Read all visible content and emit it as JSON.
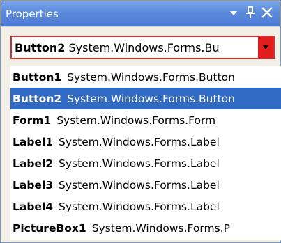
{
  "titlebar": {
    "title": "Properties",
    "dropdown_glyph": "▾",
    "pin_glyph": "ꟸ",
    "close_glyph": "✕"
  },
  "combo": {
    "selected_name": "Button2",
    "selected_type": "System.Windows.Forms.Bu",
    "drop_color": "#e11d1d"
  },
  "list": {
    "items": [
      {
        "name": "Button1",
        "type": "System.Windows.Forms.Button",
        "selected": false
      },
      {
        "name": "Button2",
        "type": "System.Windows.Forms.Button",
        "selected": true
      },
      {
        "name": "Form1",
        "type": "System.Windows.Forms.Form",
        "selected": false
      },
      {
        "name": "Label1",
        "type": "System.Windows.Forms.Label",
        "selected": false
      },
      {
        "name": "Label2",
        "type": "System.Windows.Forms.Label",
        "selected": false
      },
      {
        "name": "Label3",
        "type": "System.Windows.Forms.Label",
        "selected": false
      },
      {
        "name": "Label4",
        "type": "System.Windows.Forms.Label",
        "selected": false
      },
      {
        "name": "PictureBox1",
        "type": "System.Windows.Forms.P",
        "selected": false
      }
    ]
  },
  "colors": {
    "selection": "#316ac5",
    "titlebar": "#5a89dc"
  }
}
